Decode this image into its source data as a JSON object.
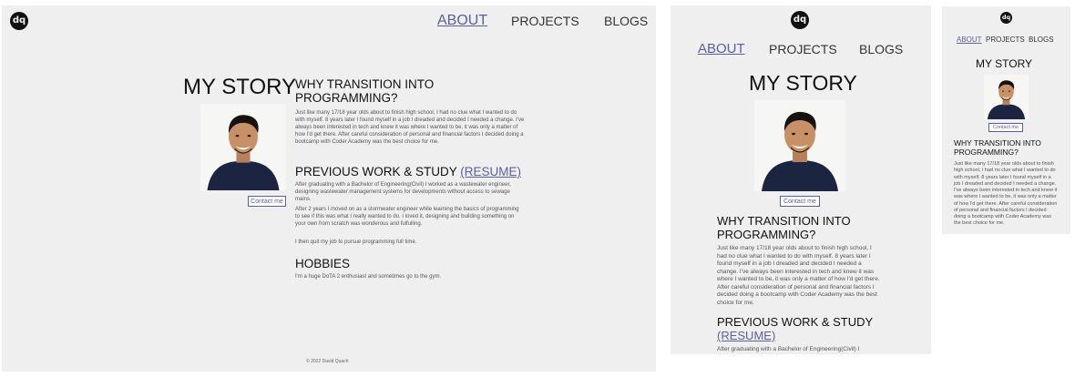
{
  "site": {
    "logo_text": "dq",
    "nav": {
      "about": "ABOUT",
      "projects": "PROJECTS",
      "blogs": "BLOGS"
    },
    "story_title": "MY STORY",
    "contact_label": "Contact me",
    "sections": {
      "transition": {
        "title": "WHY TRANSITION INTO PROGRAMMING?",
        "title_line1": "WHY TRANSITION INTO",
        "title_line2": "PROGRAMMING?",
        "body": "Just like many 17/18 year olds about to finish high school, I had no clue what I wanted to do with myself. 8 years later I found myself in a job I dreaded and decided I needed a change. I've always been interested in tech and knew it was where I wanted to be, it was only a matter of how I'd get there. After careful consideration of personal and financial factors I decided doing a bootcamp with Coder Academy was the best choice for me."
      },
      "work": {
        "title": "PREVIOUS WORK & STUDY",
        "resume_link": "(RESUME)",
        "body1": "After graduating with a Bachelor of Engineering(Civil) I worked as a wastewater engineer, designing wastewater management systems for developments without access to sewage mains.",
        "body1_truncated": "After graduating with a Bachelor of Engineering(Civil) I",
        "body2": "After 2 years I moved on as a stormwater engineer while learning the basics of programming to see if this was what I really wanted to do. I loved it, designing and building something on your own from scratch was wonderous and fulfulling.",
        "body3": "I then quit my job to pursue programming full time."
      },
      "hobbies": {
        "title": "HOBBIES",
        "body": "I'm a huge DoTA 2 enthusiast and sometimes go to the gym."
      }
    },
    "footer": "© 2022 David Quach",
    "colors": {
      "accent": "#5c5ea2",
      "panel_bg": "#efefef",
      "text": "#111111",
      "muted_text": "#555555"
    }
  }
}
